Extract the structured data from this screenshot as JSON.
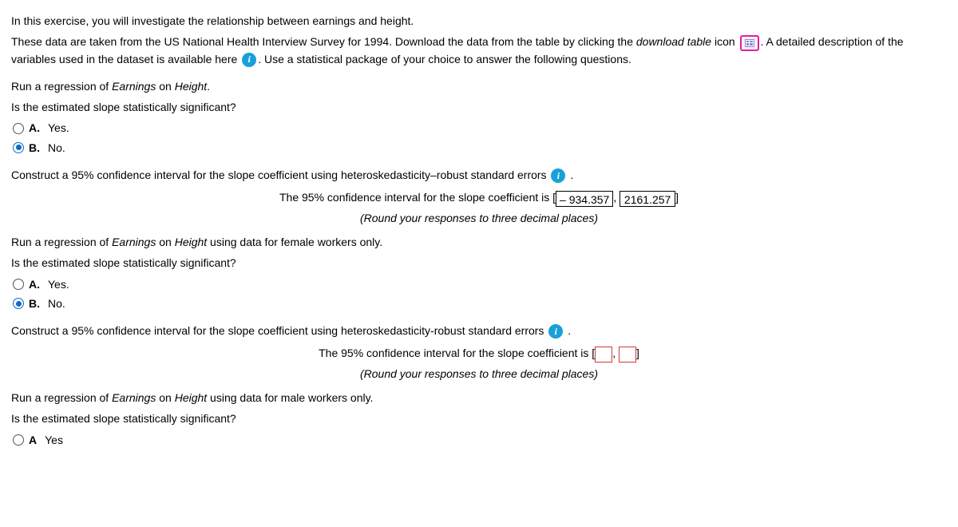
{
  "intro": {
    "p1": "In this exercise, you will investigate the relationship between earnings and height.",
    "p2a": "These data are taken from the US National Health Interview Survey for 1994. Download the data from the table by clicking the ",
    "p2b": "download table",
    "p2c": " icon ",
    "p2d": ". A detailed description of the variables used in the dataset is available here ",
    "p2e": ". Use a statistical package of your choice to answer the following questions."
  },
  "q1": {
    "line1a": "Run a regression of ",
    "line1b": "Earnings",
    "line1c": " on ",
    "line1d": "Height",
    "line1e": ".",
    "line2": "Is the estimated slope statistically significant?",
    "optA": "A.",
    "optA_text": "Yes.",
    "optB": "B.",
    "optB_text": "No."
  },
  "ci1": {
    "prompt": "Construct a 95% confidence interval for the slope coefficient using heteroskedasticity–robust standard errors ",
    "line_a": "The 95% confidence interval for the slope coefficient is [",
    "val_lo": "– 934.357",
    "comma": ", ",
    "val_hi": "2161.257",
    "line_b": "]",
    "hint_a": "(Round your responses to three decimal places)"
  },
  "q2": {
    "line1a": "Run a regression of ",
    "line1b": "Earnings",
    "line1c": " on ",
    "line1d": "Height",
    "line1e": " using data for female workers only.",
    "line2": "Is the estimated slope statistically significant?",
    "optA": "A.",
    "optA_text": "Yes.",
    "optB": "B.",
    "optB_text": "No."
  },
  "ci2": {
    "prompt": "Construct a 95% confidence interval for the slope coefficient using heteroskedasticity-robust standard errors ",
    "line_a": "The 95% confidence interval for the slope coefficient is [",
    "comma": ", ",
    "line_b": "]",
    "hint_a": "(Round your responses to three decimal places)"
  },
  "q3": {
    "line1a": "Run a regression of ",
    "line1b": "Earnings",
    "line1c": " on ",
    "line1d": "Height",
    "line1e": " using data for male workers only.",
    "line2": "Is the estimated slope statistically significant?",
    "optA": "A",
    "optA_text": "Yes"
  }
}
